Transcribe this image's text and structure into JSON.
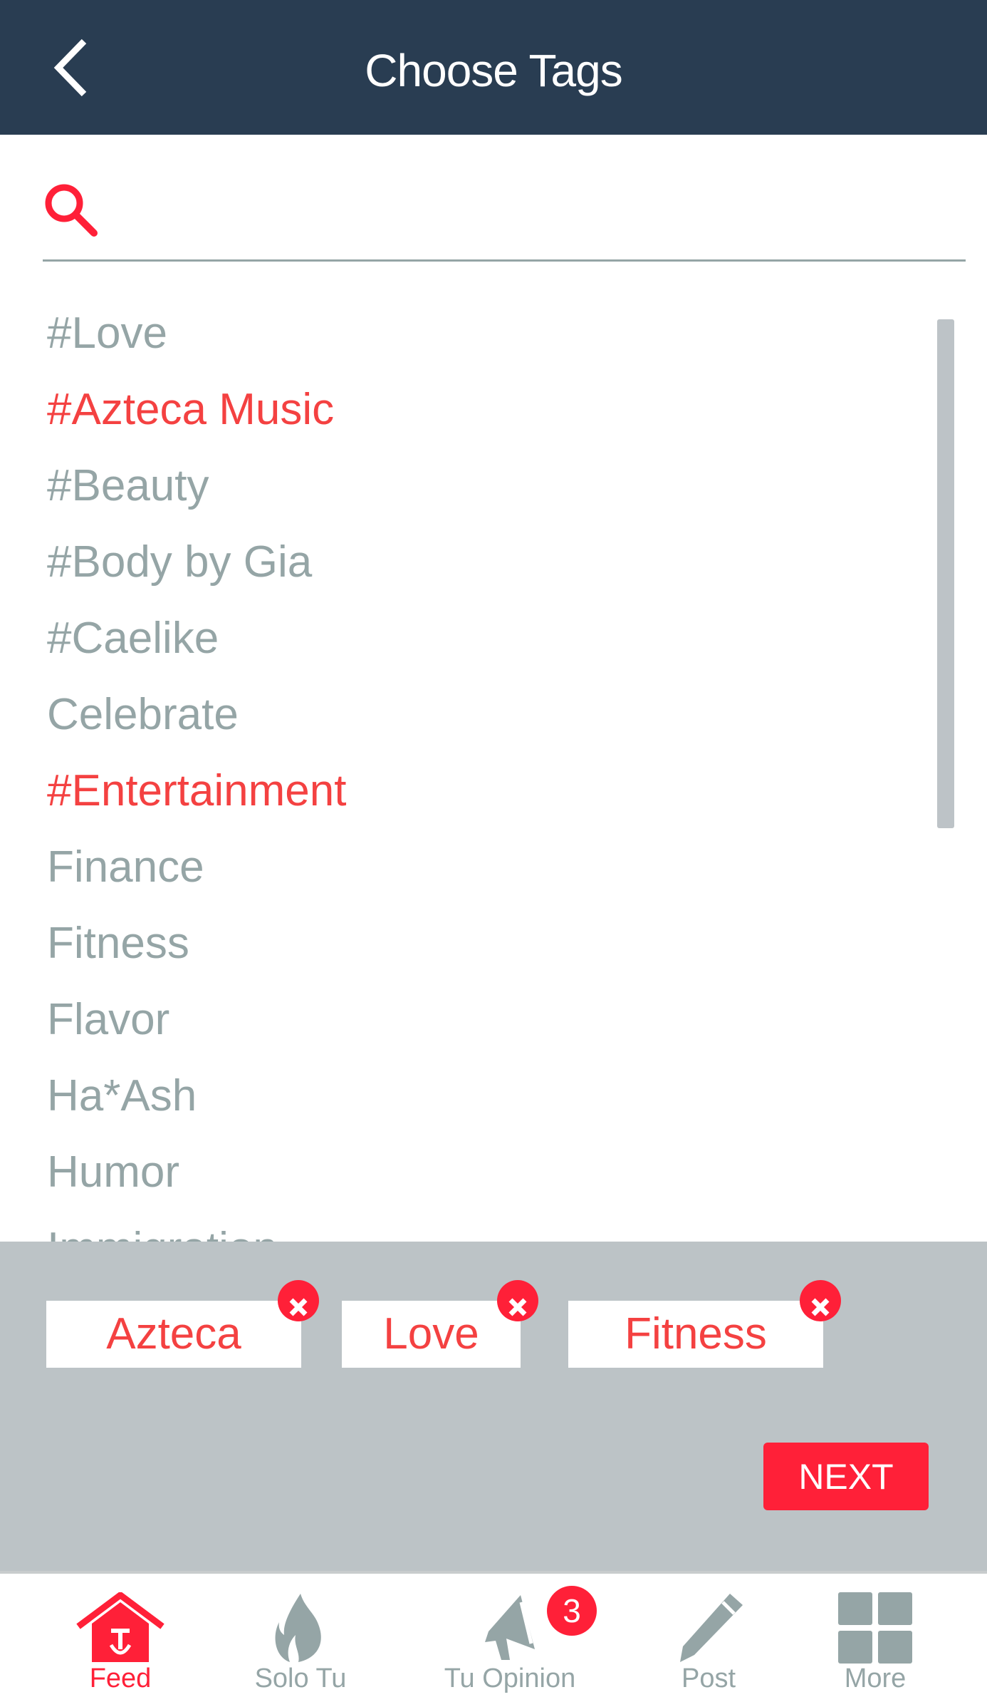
{
  "header": {
    "title": "Choose Tags",
    "back_icon": "chevron-left-icon"
  },
  "search": {
    "icon": "search-icon",
    "value": "",
    "placeholder": ""
  },
  "tags": [
    {
      "label": "#Love",
      "selected": false
    },
    {
      "label": "#Azteca Music",
      "selected": true
    },
    {
      "label": "#Beauty",
      "selected": false
    },
    {
      "label": "#Body by Gia",
      "selected": false
    },
    {
      "label": "#Caelike",
      "selected": false
    },
    {
      "label": "Celebrate",
      "selected": false
    },
    {
      "label": "#Entertainment",
      "selected": true
    },
    {
      "label": "Finance",
      "selected": false
    },
    {
      "label": "Fitness",
      "selected": false
    },
    {
      "label": "Flavor",
      "selected": false
    },
    {
      "label": "Ha*Ash",
      "selected": false
    },
    {
      "label": "Humor",
      "selected": false
    },
    {
      "label": "Immigration",
      "selected": false
    }
  ],
  "selected_chips": [
    "Azteca",
    "Love",
    "Fitness"
  ],
  "next_label": "NEXT",
  "nav": {
    "items": [
      {
        "label": "Feed",
        "icon": "home-icon",
        "active": true
      },
      {
        "label": "Solo Tu",
        "icon": "flame-icon",
        "active": false
      },
      {
        "label": "Tu Opinion",
        "icon": "megaphone-icon",
        "active": false,
        "badge": "3"
      },
      {
        "label": "Post",
        "icon": "pencil-icon",
        "active": false
      },
      {
        "label": "More",
        "icon": "grid-icon",
        "active": false
      }
    ]
  },
  "colors": {
    "header": "#293d52",
    "accent": "#ff2038",
    "text_gray": "#95a5a6",
    "panel": "#bcc3c6"
  }
}
